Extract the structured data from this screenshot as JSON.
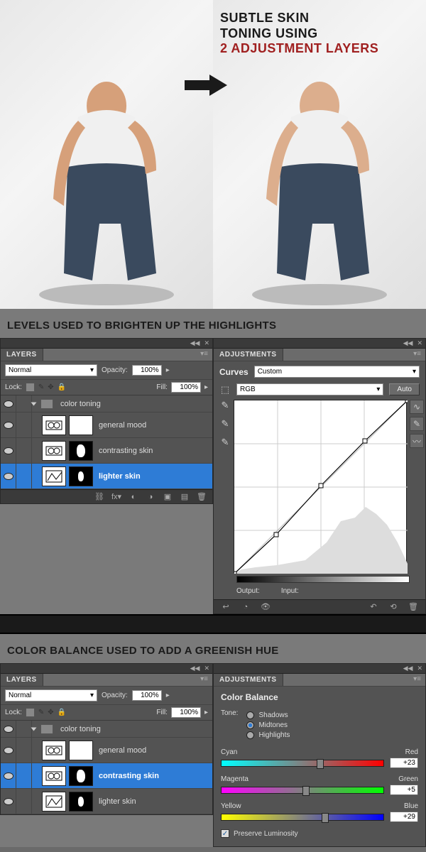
{
  "top": {
    "title_line1": "Subtle skin",
    "title_line2": "toning using",
    "title_red": "2 adjustment layers"
  },
  "section1": {
    "caption": "Levels used to brighten up the highlights",
    "layers": {
      "tab": "LAYERS",
      "blend_mode": "Normal",
      "opacity_label": "Opacity:",
      "opacity": "100%",
      "lock_label": "Lock:",
      "fill_label": "Fill:",
      "fill": "100%",
      "group": "color toning",
      "items": [
        {
          "name": "general mood",
          "mask": "white",
          "selected": false
        },
        {
          "name": "contrasting skin",
          "mask": "dark",
          "selected": false
        },
        {
          "name": "lighter skin",
          "mask": "dark",
          "selected": true
        }
      ]
    },
    "curves": {
      "tab": "ADJUSTMENTS",
      "type_label": "Curves",
      "preset": "Custom",
      "channel": "RGB",
      "auto": "Auto",
      "output_label": "Output:",
      "input_label": "Input:"
    }
  },
  "section2": {
    "caption": "Color balance used to add a greenish hue",
    "layers": {
      "tab": "LAYERS",
      "blend_mode": "Normal",
      "opacity_label": "Opacity:",
      "opacity": "100%",
      "lock_label": "Lock:",
      "fill_label": "Fill:",
      "fill": "100%",
      "group": "color toning",
      "items": [
        {
          "name": "general mood",
          "mask": "white",
          "selected": false
        },
        {
          "name": "contrasting skin",
          "mask": "dark",
          "selected": true
        },
        {
          "name": "lighter skin",
          "mask": "dark",
          "selected": false
        }
      ]
    },
    "colorbalance": {
      "tab": "ADJUSTMENTS",
      "title": "Color Balance",
      "tone_label": "Tone:",
      "shadows": "Shadows",
      "midtones": "Midtones",
      "highlights": "Highlights",
      "tone_selected": "midtones",
      "cyan": "Cyan",
      "red": "Red",
      "cr_val": "+23",
      "magenta": "Magenta",
      "green": "Green",
      "mg_val": "+5",
      "yellow": "Yellow",
      "blue": "Blue",
      "yb_val": "+29",
      "preserve": "Preserve Luminosity",
      "preserve_checked": true
    }
  },
  "chart_data": {
    "type": "line",
    "title": "Curves — RGB",
    "xlabel": "Input",
    "ylabel": "Output",
    "xlim": [
      0,
      255
    ],
    "ylim": [
      0,
      255
    ],
    "points": [
      {
        "input": 0,
        "output": 0
      },
      {
        "input": 62,
        "output": 58
      },
      {
        "input": 128,
        "output": 130
      },
      {
        "input": 192,
        "output": 196
      },
      {
        "input": 255,
        "output": 255
      }
    ]
  }
}
